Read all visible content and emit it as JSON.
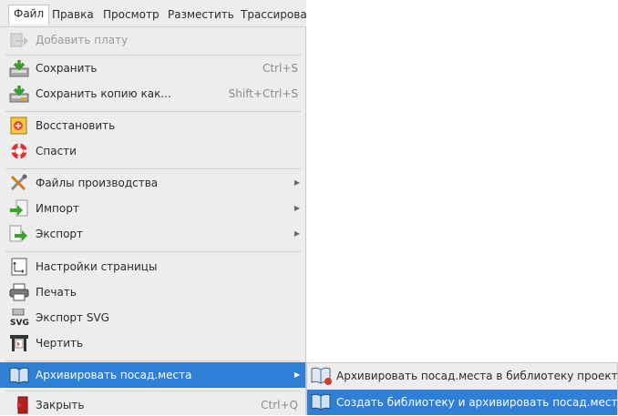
{
  "menubar": {
    "items": [
      "Файл",
      "Правка",
      "Просмотр",
      "Разместить",
      "Трассировать"
    ]
  },
  "file_menu": {
    "add_board": "Добавить плату",
    "save": "Сохранить",
    "save_shortcut": "Ctrl+S",
    "save_copy": "Сохранить копию как...",
    "save_copy_shortcut": "Shift+Ctrl+S",
    "restore": "Восстановить",
    "rescue": "Спасти",
    "fab_outputs": "Файлы производства",
    "import": "Импорт",
    "export": "Экспорт",
    "page_settings": "Настройки страницы",
    "print": "Печать",
    "export_svg": "Экспорт SVG",
    "plot": "Чертить",
    "archive_footprints": "Архивировать посад.места",
    "close": "Закрыть",
    "close_shortcut": "Ctrl+Q"
  },
  "archive_submenu": {
    "archive_to_project_lib": "Архивировать посад.места в библиотеку проекта",
    "create_lib_and_archive": "Создать библиотеку и архивировать посад.места"
  },
  "colors": {
    "highlight": "#2f7fd6",
    "menu_bg": "#ededed"
  }
}
